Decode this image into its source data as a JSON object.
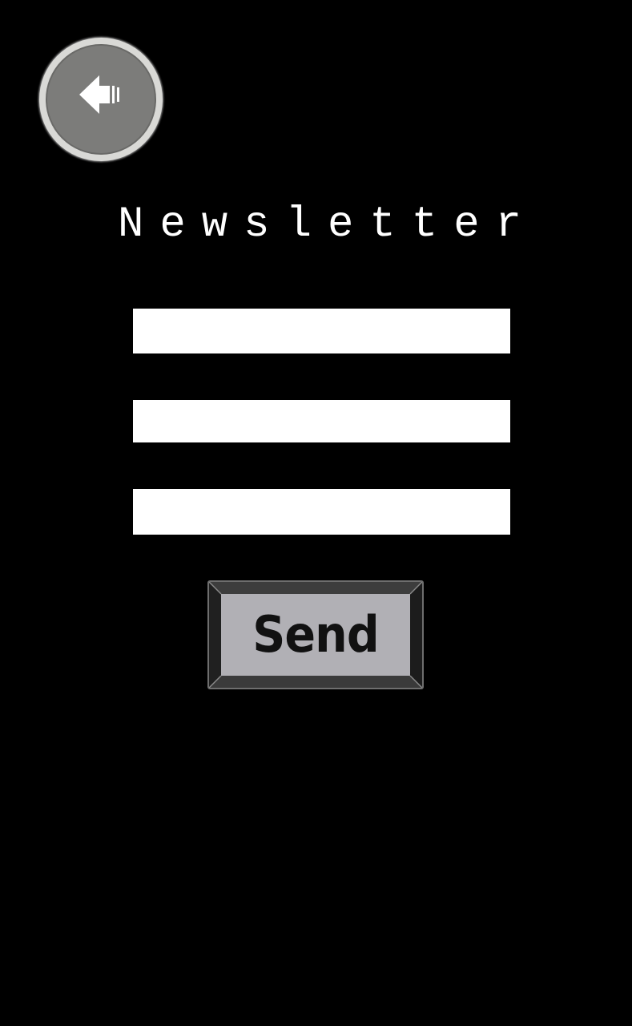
{
  "header": {
    "back_icon": "arrow-left-icon"
  },
  "page": {
    "title": "Newsletter"
  },
  "form": {
    "fields": [
      {
        "value": "",
        "placeholder": ""
      },
      {
        "value": "",
        "placeholder": ""
      },
      {
        "value": "",
        "placeholder": ""
      }
    ],
    "send_label": "Send"
  },
  "colors": {
    "background": "#000000",
    "field": "#ffffff",
    "button_face": "#b1b0b5",
    "back_button": "#7c7c7a"
  }
}
